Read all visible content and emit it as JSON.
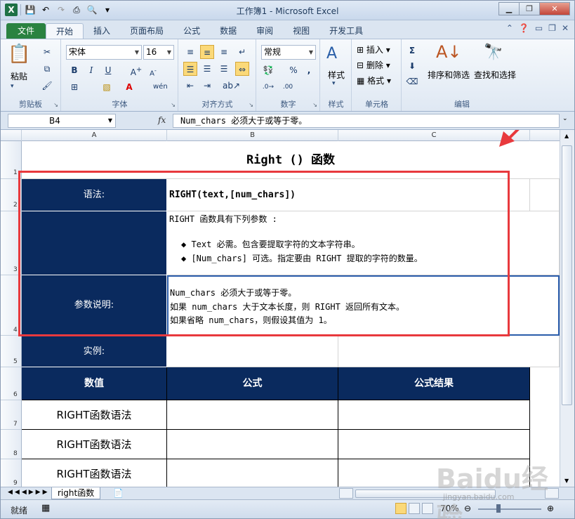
{
  "window": {
    "title": "工作簿1 - Microsoft Excel"
  },
  "tabs": [
    "文件",
    "开始",
    "插入",
    "页面布局",
    "公式",
    "数据",
    "审阅",
    "视图",
    "开发工具"
  ],
  "ribbon": {
    "paste_label": "粘贴",
    "groups": {
      "clipboard": "剪贴板",
      "font": "字体",
      "alignment": "对齐方式",
      "number": "数字",
      "styles": "样式",
      "cells": "单元格",
      "editing": "编辑"
    },
    "font_name": "宋体",
    "font_size": "16",
    "number_format": "常规",
    "style_label": "样式",
    "insert_label": "插入",
    "delete_label": "删除",
    "format_label": "格式",
    "sort_label": "排序和筛选",
    "find_label": "查找和选择"
  },
  "formula_bar": {
    "cell_ref": "B4",
    "formula": "Num_chars 必须大于或等于零。"
  },
  "columns": [
    "A",
    "B",
    "C"
  ],
  "rows": [
    "1",
    "2",
    "3",
    "4",
    "5",
    "6",
    "7",
    "8",
    "9"
  ],
  "sheet": {
    "title": "Right () 函数",
    "syntax_label": "语法:",
    "syntax_value": "RIGHT(text,[num_chars])",
    "params_intro": "RIGHT 函数具有下列参数 :",
    "param1": "◆ Text  必需。包含要提取字符的文本字符串。",
    "param2": "◆ [Num_chars]  可选。指定要由 RIGHT 提取的字符的数量。",
    "desc_label": "参数说明:",
    "desc1": "Num_chars 必须大于或等于零。",
    "desc2": "如果 num_chars 大于文本长度，则 RIGHT 返回所有文本。",
    "desc3": "如果省略 num_chars，则假设其值为 1。",
    "example_label": "实例:",
    "table_headers": [
      "数值",
      "公式",
      "公式结果"
    ],
    "table_rows": [
      "RIGHT函数语法",
      "RIGHT函数语法",
      "RIGHT函数语法"
    ]
  },
  "sheet_tab": "right函数",
  "status": {
    "ready": "就绪",
    "zoom": "70%"
  },
  "watermark": "Baidu经验",
  "watermark_sub": "jingyan.baidu.com"
}
